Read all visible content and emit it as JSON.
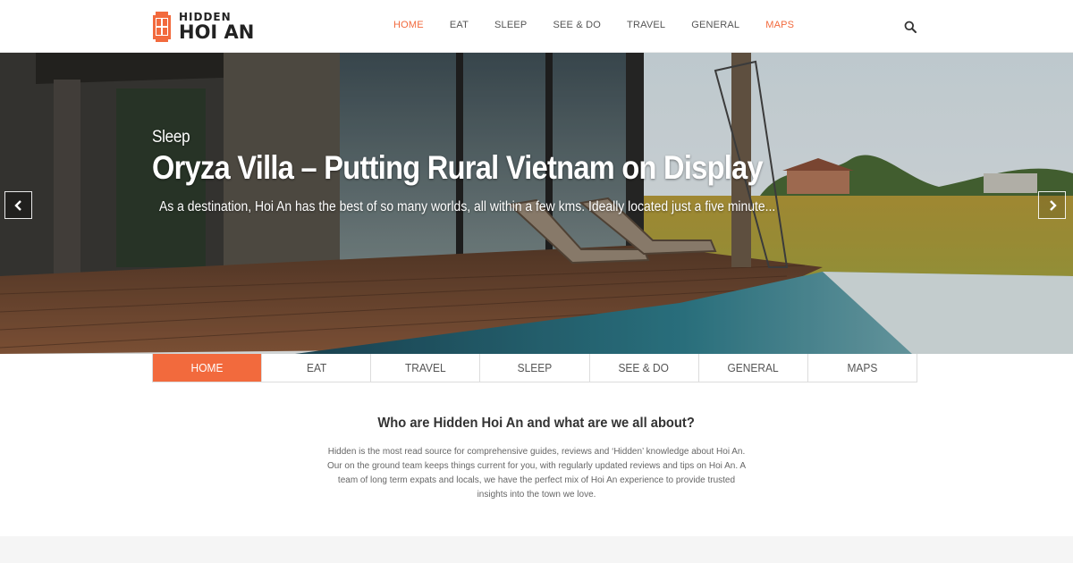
{
  "brand": {
    "name_top": "HIDDEN",
    "name_bottom": "HOI AN",
    "accent_color": "#f26a3d"
  },
  "nav": {
    "items": [
      {
        "label": "HOME",
        "state": "active"
      },
      {
        "label": "EAT"
      },
      {
        "label": "SLEEP"
      },
      {
        "label": "SEE & DO"
      },
      {
        "label": "TRAVEL"
      },
      {
        "label": "GENERAL"
      },
      {
        "label": "MAPS",
        "state": "accent"
      }
    ],
    "search_icon": "search-icon"
  },
  "hero": {
    "category": "Sleep",
    "title": "Oryza Villa –  Putting Rural Vietnam on Display",
    "excerpt": "As a destination, Hoi An has the best of so many worlds, all within a few kms. Ideally located just a five minute...",
    "prev_icon": "chevron-left-icon",
    "next_icon": "chevron-right-icon"
  },
  "tabs": [
    {
      "label": "HOME",
      "active": true
    },
    {
      "label": "EAT"
    },
    {
      "label": "TRAVEL"
    },
    {
      "label": "SLEEP"
    },
    {
      "label": "SEE & DO"
    },
    {
      "label": "GENERAL"
    },
    {
      "label": "MAPS"
    }
  ],
  "about": {
    "heading": "Who are Hidden Hoi An and what are we all about?",
    "body": "Hidden is the most read source for comprehensive guides, reviews and ‘Hidden’ knowledge about Hoi An. Our on the ground team keeps things current for you, with regularly updated reviews and tips on Hoi An. A team of long term expats and locals, we have the perfect mix of Hoi An experience to provide trusted insights into the town we love."
  }
}
